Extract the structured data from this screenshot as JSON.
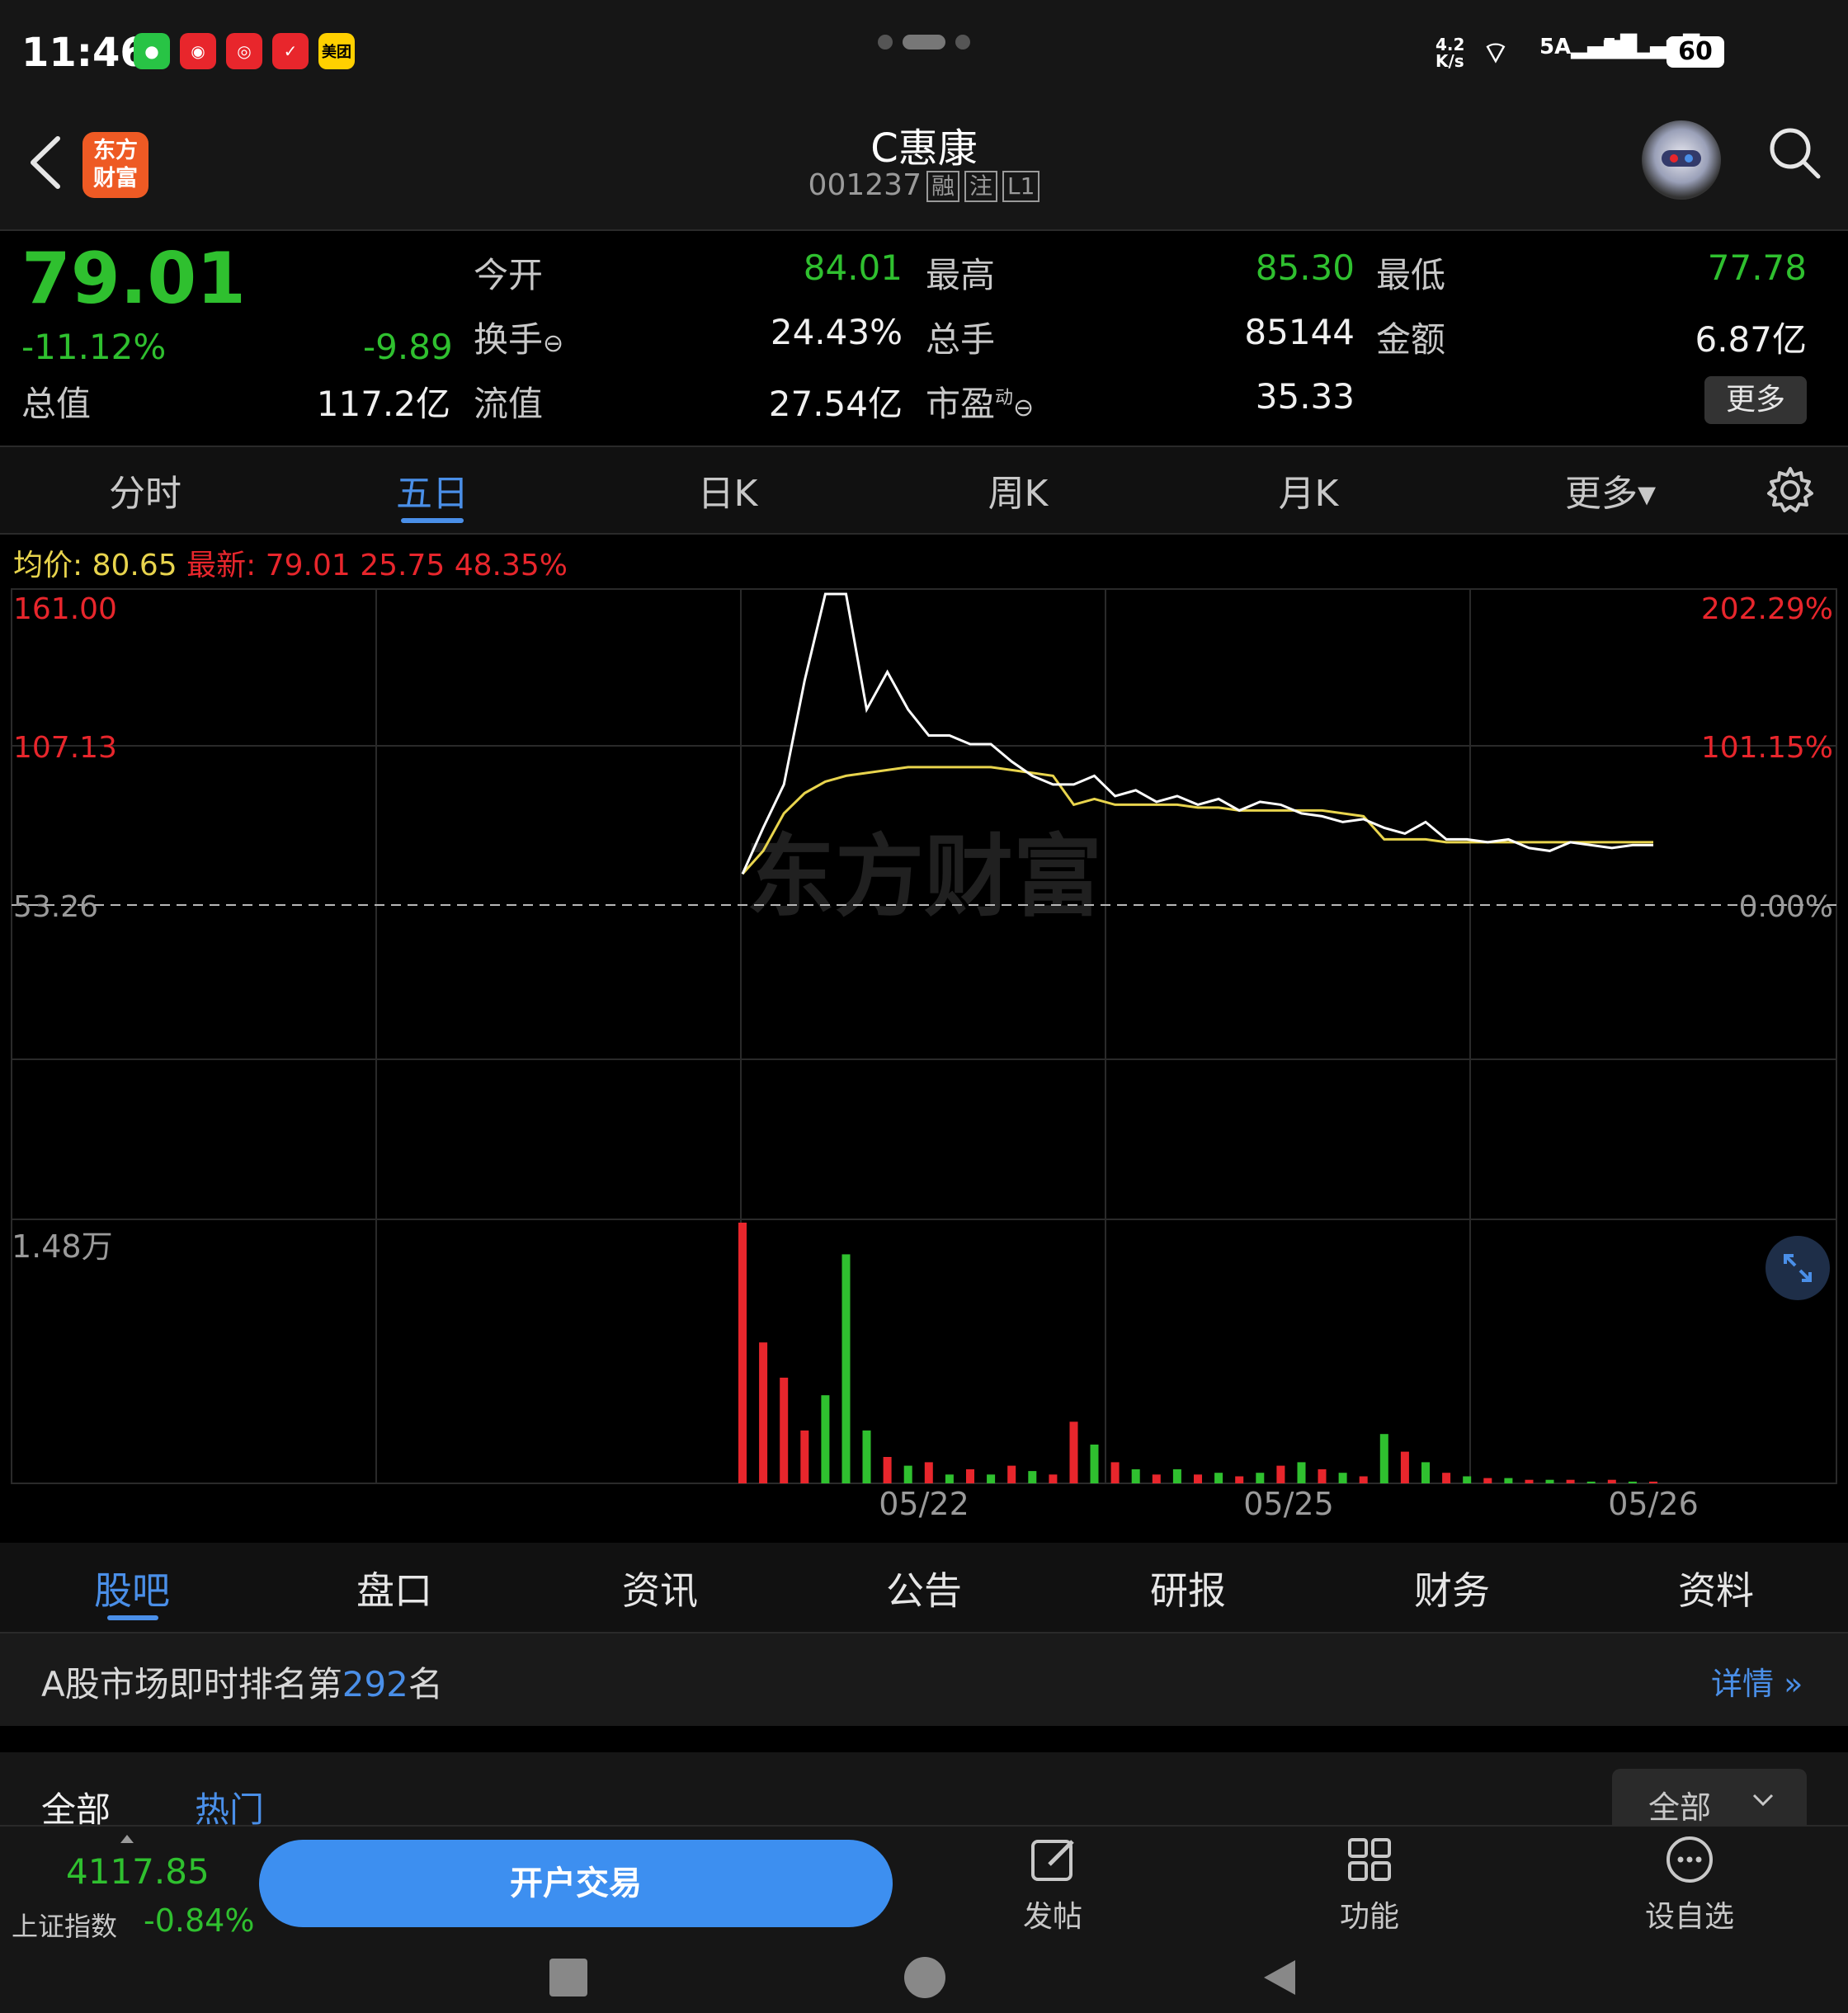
{
  "status_bar": {
    "time": "11:46",
    "apps": [
      "wechat-icon",
      "weibo-like-icon",
      "netease-icon",
      "kuaishou-icon",
      "meituan-icon"
    ],
    "meituan_label": "美团",
    "net_speed_top": "4.2",
    "net_speed_bottom": "K/s",
    "signal1": "5A",
    "signal2": "5A",
    "battery": "60"
  },
  "header": {
    "logo_line1": "东方",
    "logo_line2": "财富",
    "stock_name": "C惠康",
    "stock_code": "001237",
    "tags": [
      "融",
      "注",
      "L1"
    ]
  },
  "quote": {
    "price": "79.01",
    "change_pct": "-11.12%",
    "change": "-9.89",
    "total_value_label": "总值",
    "total_value": "117.2亿",
    "open_label": "今开",
    "open": "84.01",
    "high_label": "最高",
    "high": "85.30",
    "low_label": "最低",
    "low": "77.78",
    "turnover_label": "换手",
    "turnover": "24.43%",
    "volume_label": "总手",
    "volume": "85144",
    "amount_label": "金额",
    "amount": "6.87亿",
    "float_label": "流值",
    "float_value": "27.54亿",
    "pe_label": "市盈",
    "pe_sup": "动",
    "pe": "35.33",
    "more": "更多"
  },
  "period_tabs": [
    "分时",
    "五日",
    "日K",
    "周K",
    "月K",
    "更多▾"
  ],
  "chart_legend": {
    "avg_label": "均价:",
    "avg": "80.65",
    "latest_label": "最新:",
    "latest": "79.01 25.75 48.35%"
  },
  "chart_data": {
    "type": "line",
    "price_axis_left": [
      "161.00",
      "107.13",
      "53.26"
    ],
    "price_axis_right": [
      "202.29%",
      "101.15%",
      "0.00%"
    ],
    "ylim": [
      53.26,
      161.0
    ],
    "volume_max_label": "1.48万",
    "watermark": "东方财富",
    "x_labels": [
      "05/22",
      "05/25",
      "05/26"
    ],
    "colors": {
      "price": "#ffffff",
      "avg": "#e8d44d",
      "up": "#e8262c",
      "down": "#2fc02f"
    },
    "series": [
      {
        "name": "最新",
        "values": [
          64,
          80,
          95,
          131,
          161,
          161,
          121,
          134,
          121,
          112,
          112,
          109,
          109,
          103,
          98,
          95,
          95,
          98,
          91,
          93,
          89,
          91,
          88,
          90,
          86,
          89,
          88,
          85,
          84,
          82,
          83,
          80,
          78,
          82,
          76,
          76,
          75,
          76,
          73,
          72,
          75,
          74,
          73,
          74,
          74
        ]
      },
      {
        "name": "均价",
        "values": [
          64,
          72,
          85,
          92,
          96,
          98,
          99,
          100,
          101,
          101,
          101,
          101,
          101,
          100,
          99,
          98,
          88,
          90,
          88,
          88,
          88,
          88,
          87,
          87,
          86,
          86,
          86,
          86,
          86,
          85,
          84,
          76,
          76,
          76,
          75,
          75,
          75,
          75,
          75,
          75,
          75,
          75,
          75,
          75,
          75
        ]
      }
    ],
    "volume": [
      1.48,
      0.8,
      0.6,
      0.3,
      0.5,
      1.3,
      0.3,
      0.15,
      0.1,
      0.12,
      0.05,
      0.08,
      0.05,
      0.1,
      0.07,
      0.05,
      0.35,
      0.22,
      0.12,
      0.08,
      0.05,
      0.08,
      0.05,
      0.06,
      0.04,
      0.06,
      0.1,
      0.12,
      0.08,
      0.06,
      0.04,
      0.28,
      0.18,
      0.12,
      0.06,
      0.04,
      0.03,
      0.03,
      0.02,
      0.02,
      0.02,
      0.01,
      0.02,
      0.01,
      0.01
    ],
    "volume_up": [
      true,
      true,
      true,
      true,
      false,
      false,
      false,
      true,
      false,
      true,
      false,
      true,
      false,
      true,
      false,
      true,
      true,
      false,
      true,
      false,
      true,
      false,
      true,
      false,
      true,
      false,
      true,
      false,
      true,
      false,
      true,
      false,
      true,
      false,
      true,
      false,
      true,
      false,
      true,
      false,
      true,
      false,
      true,
      false,
      true
    ]
  },
  "info_tabs": [
    "股吧",
    "盘口",
    "资讯",
    "公告",
    "研报",
    "财务",
    "资料"
  ],
  "rank": {
    "prefix": "A股市场即时排名第",
    "number": "292",
    "suffix": "名",
    "detail": "详情"
  },
  "filter": {
    "all": "全部",
    "hot": "热门",
    "dropdown": "全部"
  },
  "bottom_bar": {
    "index_value": "4117.85",
    "index_name": "上证指数",
    "index_pct": "-0.84%",
    "trade_button": "开户交易",
    "nav": [
      "发帖",
      "功能",
      "设自选"
    ]
  }
}
